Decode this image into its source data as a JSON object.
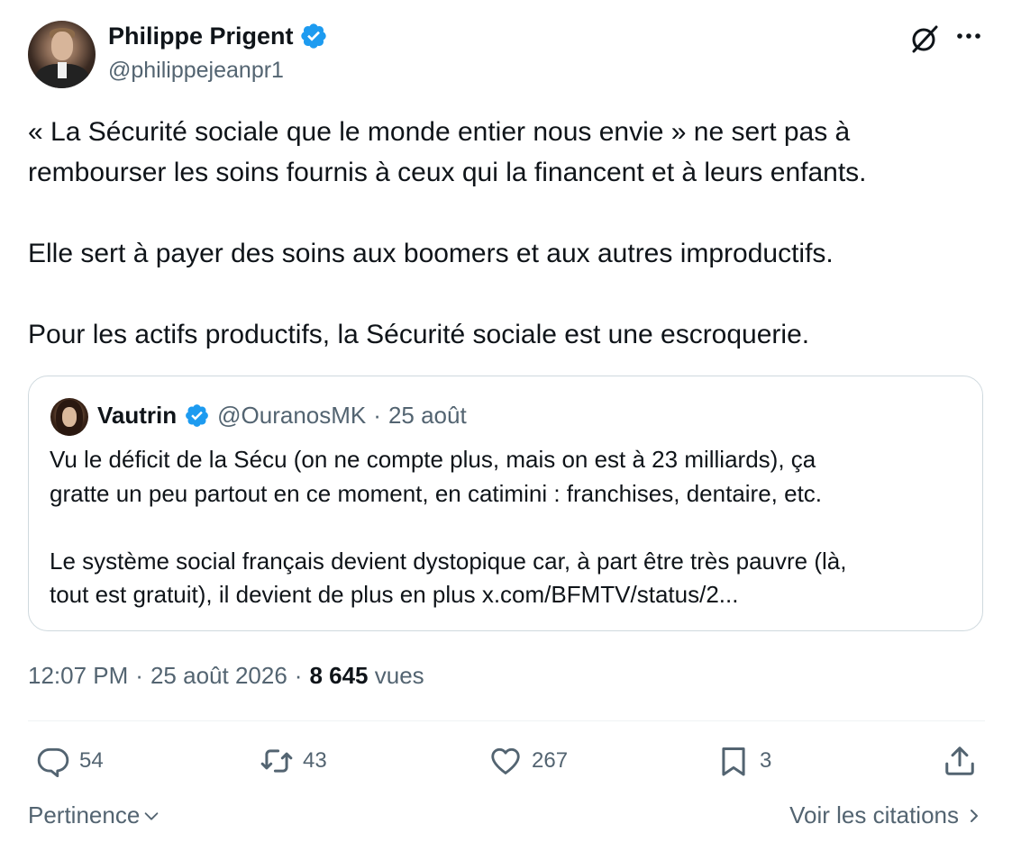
{
  "author": {
    "name": "Philippe Prigent",
    "handle": "@philippejeanpr1"
  },
  "tweet": {
    "paragraphs": [
      [
        "« La Sécurité sociale que le monde entier nous envie » ne sert pas à",
        "rembourser les soins fournis à ceux qui la financent et à leurs enfants."
      ],
      [
        "Elle sert à payer des soins aux boomers et aux autres improductifs."
      ],
      [
        "Pour les actifs productifs, la Sécurité sociale est une escroquerie."
      ]
    ]
  },
  "quote": {
    "name": "Vautrin",
    "handle": "@OuranosMK",
    "separator": "·",
    "date": "25 août",
    "lines": [
      "Vu le déficit de la Sécu (on ne compte plus, mais on est à 23 milliards), ça",
      "gratte un peu partout en ce moment, en catimini : franchises, dentaire, etc.",
      "",
      "Le système social français devient dystopique car, à part être très pauvre (là,",
      "tout est gratuit), il devient de plus en plus x.com/BFMTV/status/2..."
    ]
  },
  "meta": {
    "time": "12:07 PM",
    "sep": "·",
    "date": "25 août 2026",
    "views_count": "8 645",
    "views_label": "vues"
  },
  "actions": {
    "replies": "54",
    "reposts": "43",
    "likes": "267",
    "bookmarks": "3"
  },
  "footer": {
    "sort_label": "Pertinence",
    "quotes_label": "Voir les citations"
  },
  "colors": {
    "verified": "#1d9bf0",
    "text": "#0f1419",
    "muted": "#536471",
    "border": "#cfd9de"
  },
  "icons": [
    "verified-badge-icon",
    "grok-icon",
    "more-icon",
    "reply-icon",
    "repost-icon",
    "like-icon",
    "bookmark-icon",
    "share-icon",
    "chevron-down-icon",
    "chevron-right-icon"
  ]
}
